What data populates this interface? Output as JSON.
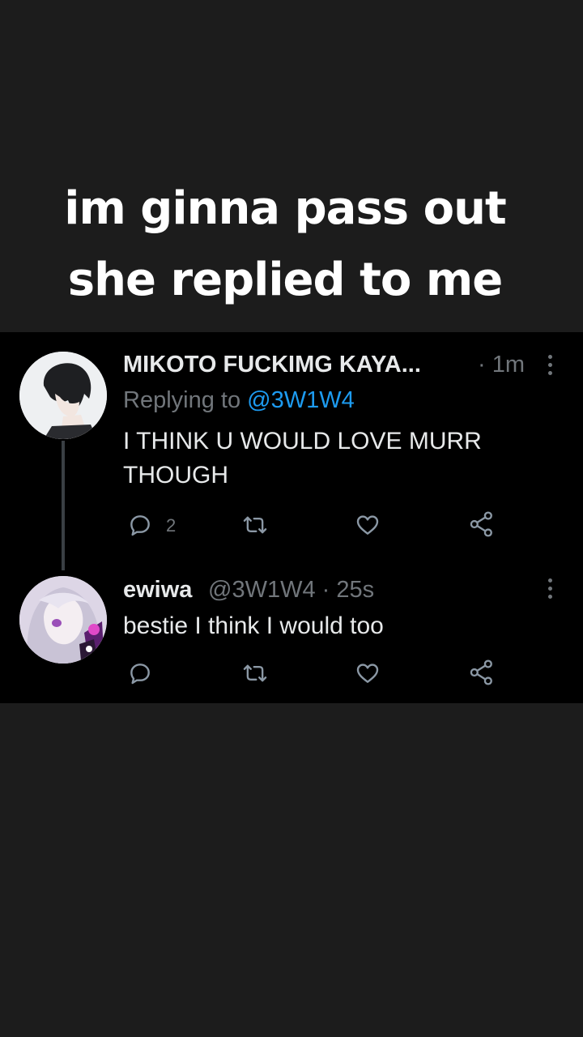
{
  "caption": {
    "line1": "im ginna pass out",
    "line2": "she replied to me"
  },
  "tweet1": {
    "display_name": "MIKOTO FUCKIMG KAYA...",
    "time": "· 1m",
    "replying_prefix": "Replying to",
    "replying_handle": "@3W1W4",
    "text_line1": "I THINK U WOULD LOVE MURR",
    "text_line2": "THOUGH",
    "reply_count": "2"
  },
  "tweet2": {
    "display_name": "ewiwa",
    "handle_time": "@3W1W4 · 25s",
    "text": "bestie I think I would too"
  },
  "icons": [
    "reply-icon",
    "retweet-icon",
    "like-icon",
    "share-icon",
    "more-icon"
  ],
  "colors": {
    "page_background": "#1c1c1c",
    "panel_background": "#000000",
    "link": "#1d9bf0",
    "secondary_text": "#71767b"
  }
}
